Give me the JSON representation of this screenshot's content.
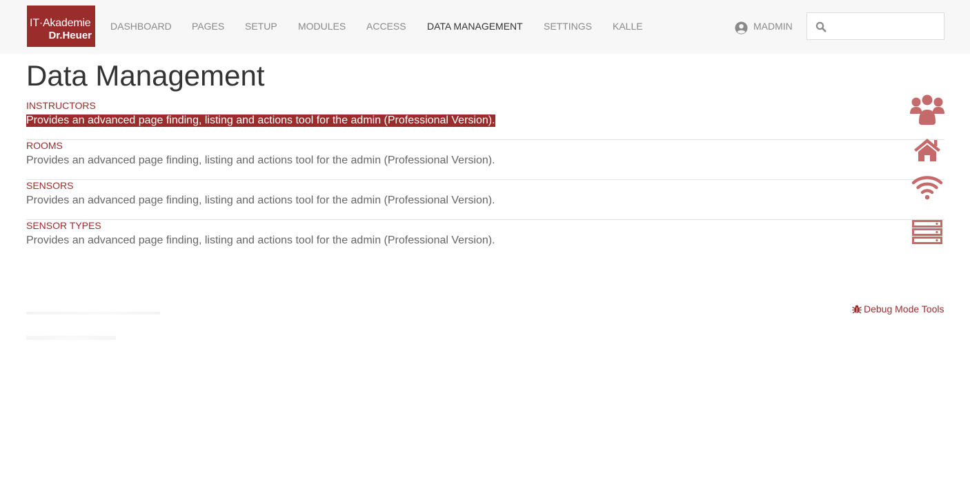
{
  "header": {
    "logo_line1": "IT·Akademie",
    "logo_line2": "Dr.Heuer",
    "nav": [
      {
        "label": "DASHBOARD"
      },
      {
        "label": "PAGES"
      },
      {
        "label": "SETUP"
      },
      {
        "label": "MODULES"
      },
      {
        "label": "ACCESS"
      },
      {
        "label": "DATA MANAGEMENT"
      },
      {
        "label": "SETTINGS"
      },
      {
        "label": "KALLE"
      }
    ],
    "active_nav": "DATA MANAGEMENT",
    "user_name": "MADMIN",
    "search": {
      "placeholder": "",
      "value": ""
    }
  },
  "page": {
    "title": "Data Management"
  },
  "items": [
    {
      "label": "INSTRUCTORS",
      "description": "Provides an advanced page finding, listing and actions tool for the admin (Professional Version).",
      "icon": "users-icon",
      "selected": true
    },
    {
      "label": "ROOMS",
      "description": "Provides an advanced page finding, listing and actions tool for the admin (Professional Version).",
      "icon": "home-icon",
      "selected": false
    },
    {
      "label": "SENSORS",
      "description": "Provides an advanced page finding, listing and actions tool for the admin (Professional Version).",
      "icon": "wifi-icon",
      "selected": false
    },
    {
      "label": "SENSOR TYPES",
      "description": "Provides an advanced page finding, listing and actions tool for the admin (Professional Version).",
      "icon": "server-icon",
      "selected": false
    }
  ],
  "footer": {
    "debug_label": "Debug Mode Tools"
  },
  "colors": {
    "accent": "#9b2c2c",
    "icon": "#c46a6a",
    "header_bg": "#f7f7f7",
    "nav_text": "#8a8a8a"
  }
}
